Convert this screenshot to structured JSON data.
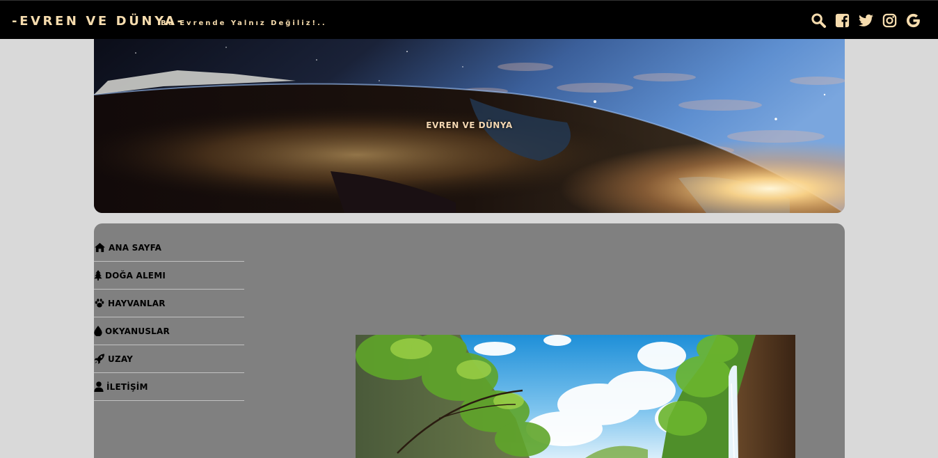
{
  "header": {
    "brand": "-EVREN VE DÜNYA-",
    "tagline": "Bu Evrende Yalnız Değiliz!..",
    "icons": [
      "search-icon",
      "facebook-icon",
      "twitter-icon",
      "instagram-icon",
      "google-icon"
    ]
  },
  "banner": {
    "title": "EVREN VE DÜNYA"
  },
  "nav": {
    "items": [
      {
        "label": "ANA SAYFA",
        "icon": "home-icon"
      },
      {
        "label": "DOĞA ALEMI",
        "icon": "tree-icon"
      },
      {
        "label": "HAYVANLAR",
        "icon": "paw-icon"
      },
      {
        "label": "OKYANUSLAR",
        "icon": "drop-icon"
      },
      {
        "label": "UZAY",
        "icon": "rocket-icon"
      },
      {
        "label": "İLETİŞİM",
        "icon": "user-icon"
      }
    ]
  },
  "colors": {
    "topbar": "#000000",
    "accent": "#f6dcae",
    "page_bg": "#d9d9d9",
    "panel_bg": "#808080"
  }
}
